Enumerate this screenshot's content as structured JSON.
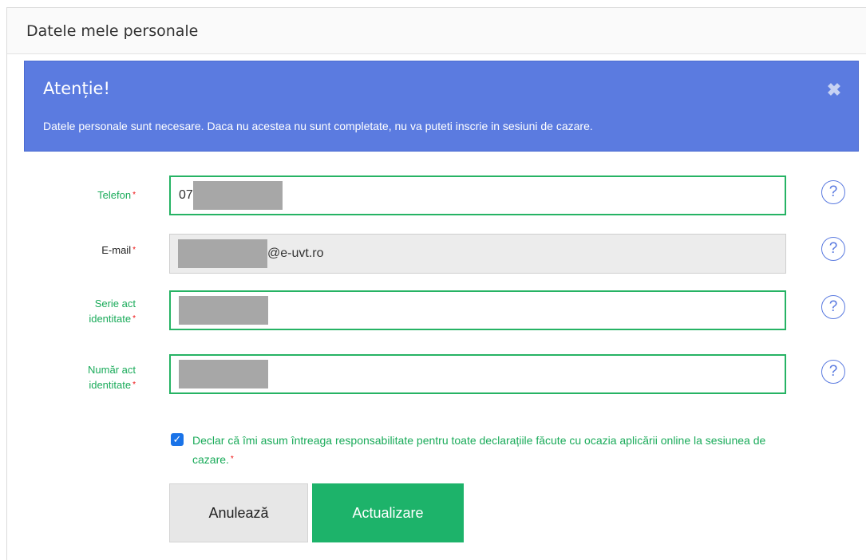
{
  "panel": {
    "title": "Datele mele personale"
  },
  "alert": {
    "title": "Atenție!",
    "message": "Datele personale sunt necesare. Daca nu acestea nu sunt completate, nu va puteti inscrie in sesiuni de cazare.",
    "close_symbol": "✖"
  },
  "form": {
    "required_mark": "*",
    "help_symbol": "?",
    "phone": {
      "label": "Telefon",
      "value_prefix": "07"
    },
    "email": {
      "label": "E-mail",
      "value_suffix": "@e-uvt.ro"
    },
    "id_series": {
      "label_line1": "Serie act",
      "label_line2": "identitate"
    },
    "id_number": {
      "label_line1": "Număr act",
      "label_line2": "identitate"
    },
    "declaration": {
      "checked": true,
      "text": "Declar că îmi asum întreaga responsabilitate pentru toate declarațiile făcute cu ocazia aplicării online la sesiunea de cazare."
    }
  },
  "buttons": {
    "cancel": "Anulează",
    "update": "Actualizare"
  },
  "colors": {
    "alert_bg": "#5b7be0",
    "accent_green": "#1db36a",
    "required_red": "#e11111"
  }
}
